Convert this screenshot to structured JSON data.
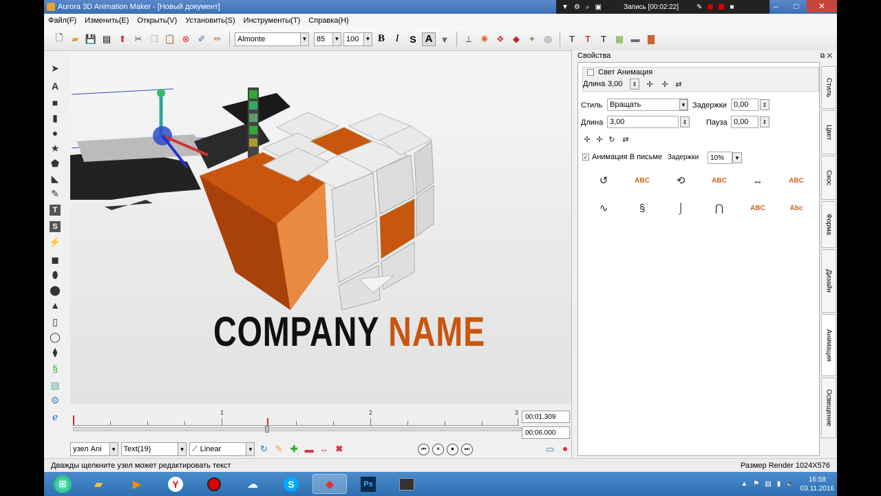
{
  "window": {
    "title": "Aurora 3D Animation Maker - [Новый документ]",
    "recording": "Запись [00:02:22]"
  },
  "menu": [
    "Файл(F)",
    "Изменить(E)",
    "Открыть(V)",
    "Установить(S)",
    "Инструменты(T)",
    "Справка(H)"
  ],
  "toolbar": {
    "font": "Almonte",
    "size": "85",
    "zoom": "100",
    "bold": "B",
    "italic": "I",
    "strike": "S",
    "text_a": "A"
  },
  "canvas": {
    "logo_word1": "COMPANY",
    "logo_word2": "NAME"
  },
  "timeline": {
    "tick_labels": [
      "1",
      "2",
      "3"
    ],
    "current_time": "00:01.309",
    "total_time": "00:06.000"
  },
  "controls": {
    "node_select": "узел Ani",
    "text_select": "Text(19)",
    "interp_select": "Linear"
  },
  "properties": {
    "header": "Свойства",
    "light_group": "Свет Анимация",
    "light_length_label": "Длина",
    "light_length_value": "3,00",
    "style_label": "Стиль",
    "style_value": "Вращать",
    "delay_label": "Задержки",
    "delay_value": "0,00",
    "length_label": "Длина",
    "length_value": "3,00",
    "pause_label": "Пауза",
    "pause_value": "0,00",
    "letter_anim_label": "Анимация В письме",
    "letter_delay_label": "Задержки",
    "letter_delay_value": "10%",
    "abc": "ABC",
    "abc_small": "Abc"
  },
  "side_tabs": [
    "Стиль",
    "Цвет",
    "Скос",
    "Форма",
    "Дизайн",
    "Анимация",
    "Освещение"
  ],
  "status": {
    "hint": "Дважды щелкните узел может редактировать текст",
    "render_size": "Размер Render 1024X576"
  },
  "taskbar": {
    "time": "16:58",
    "date": "03.11.2016"
  },
  "colors": {
    "accent_orange": "#c8560f",
    "title_blue": "#3b6fb6"
  }
}
